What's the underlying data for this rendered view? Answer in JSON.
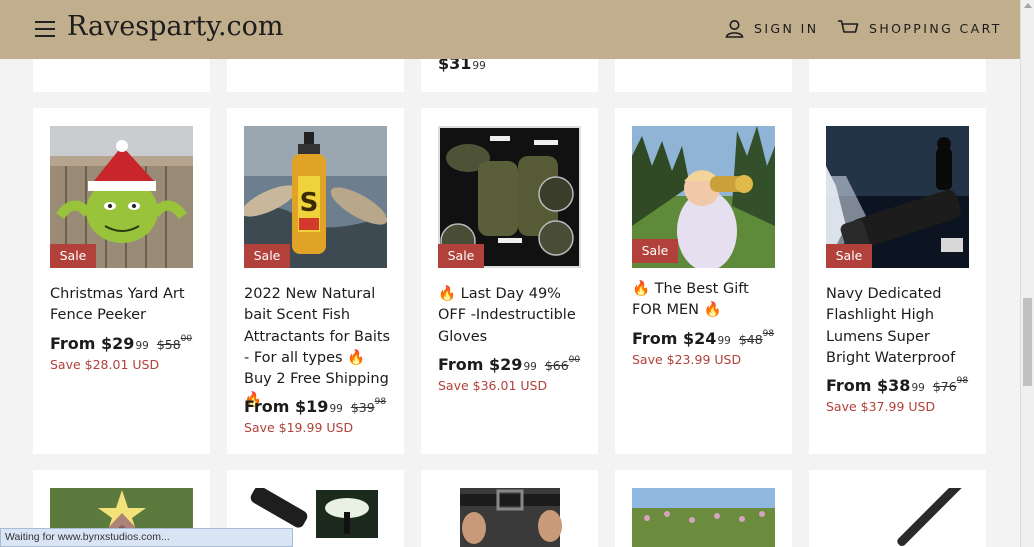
{
  "header": {
    "logo": "Ravesparty.com",
    "sign_in": "SIGN IN",
    "shopping_cart": "SHOPPING CART"
  },
  "top_row": {
    "price_dollars": "$31",
    "price_cents": "99"
  },
  "products": [
    {
      "title": "Christmas Yard Art Fence Peeker",
      "sale_badge": "Sale",
      "price_from": "From $29",
      "price_cents": "99",
      "old_price": "$58",
      "old_cents": "00",
      "save": "Save $28.01 USD"
    },
    {
      "title": "2022 New Natural bait Scent Fish Attractants for Baits - For all types 🔥 Buy 2 Free Shipping 🔥",
      "sale_badge": "Sale",
      "price_from": "From $19",
      "price_cents": "99",
      "old_price": "$39",
      "old_cents": "98",
      "save": "Save $19.99 USD"
    },
    {
      "title": "🔥 Last Day 49% OFF -Indestructible Gloves",
      "sale_badge": "Sale",
      "price_from": "From $29",
      "price_cents": "99",
      "old_price": "$66",
      "old_cents": "00",
      "save": "Save $36.01 USD"
    },
    {
      "title": "🔥 The Best Gift FOR MEN 🔥",
      "sale_badge": "Sale",
      "price_from": "From $24",
      "price_cents": "99",
      "old_price": "$48",
      "old_cents": "98",
      "save": "Save $23.99 USD"
    },
    {
      "title": "Navy Dedicated Flashlight High Lumens Super Bright Waterproof",
      "sale_badge": "Sale",
      "price_from": "From $38",
      "price_cents": "99",
      "old_price": "$76",
      "old_cents": "98",
      "save": "Save $37.99 USD"
    }
  ],
  "status_bar": "Waiting for www.bynxstudios.com...",
  "colors": {
    "header_bg": "#c0ae8d",
    "sale_badge": "#b1413a",
    "save_text": "#b1413a",
    "page_bg": "#f3f3f3"
  }
}
